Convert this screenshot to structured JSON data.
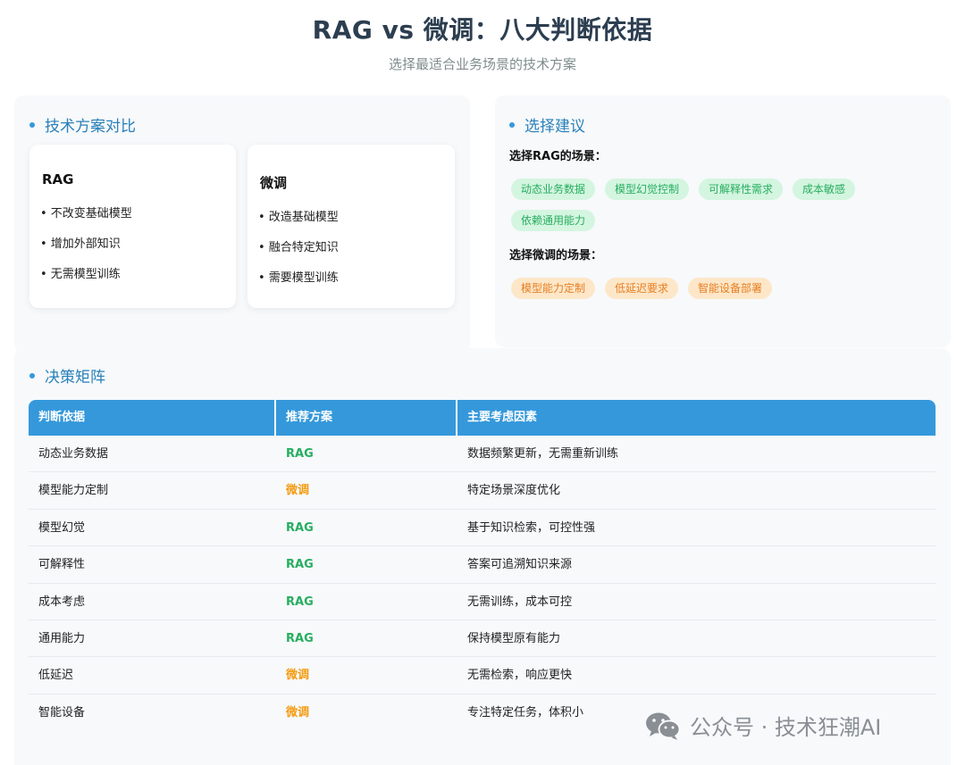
{
  "header": {
    "title": "RAG vs 微调：八大判断依据",
    "subtitle": "选择最适合业务场景的技术方案"
  },
  "comparison": {
    "heading": "技术方案对比",
    "rag": {
      "title": "RAG",
      "items": [
        "• 不改变基础模型",
        "• 增加外部知识",
        "• 无需模型训练"
      ]
    },
    "finetune": {
      "title": "微调",
      "items": [
        "• 改造基础模型",
        "• 融合特定知识",
        "• 需要模型训练"
      ]
    }
  },
  "suggestions": {
    "heading": "选择建议",
    "rag_label": "选择RAG的场景：",
    "rag_tags": [
      "动态业务数据",
      "模型幻觉控制",
      "可解释性需求",
      "成本敏感",
      "依赖通用能力"
    ],
    "ft_label": "选择微调的场景：",
    "ft_tags": [
      "模型能力定制",
      "低延迟要求",
      "智能设备部署"
    ]
  },
  "matrix": {
    "heading": "决策矩阵",
    "columns": [
      "判断依据",
      "推荐方案",
      "主要考虑因素"
    ],
    "rows": [
      {
        "basis": "动态业务数据",
        "plan": "RAG",
        "reason": "数据频繁更新，无需重新训练"
      },
      {
        "basis": "模型能力定制",
        "plan": "微调",
        "reason": "特定场景深度优化"
      },
      {
        "basis": "模型幻觉",
        "plan": "RAG",
        "reason": "基于知识检索，可控性强"
      },
      {
        "basis": "可解释性",
        "plan": "RAG",
        "reason": "答案可追溯知识来源"
      },
      {
        "basis": "成本考虑",
        "plan": "RAG",
        "reason": "无需训练，成本可控"
      },
      {
        "basis": "通用能力",
        "plan": "RAG",
        "reason": "保持模型原有能力"
      },
      {
        "basis": "低延迟",
        "plan": "微调",
        "reason": "无需检索，响应更快"
      },
      {
        "basis": "智能设备",
        "plan": "微调",
        "reason": "专注特定任务，体积小"
      }
    ]
  },
  "watermark": {
    "icon": "wechat-icon",
    "text": "公众号 · 技术狂潮AI"
  },
  "colors": {
    "accent": "#3498db",
    "rag": "#27ae60",
    "finetune": "#f39c12"
  }
}
